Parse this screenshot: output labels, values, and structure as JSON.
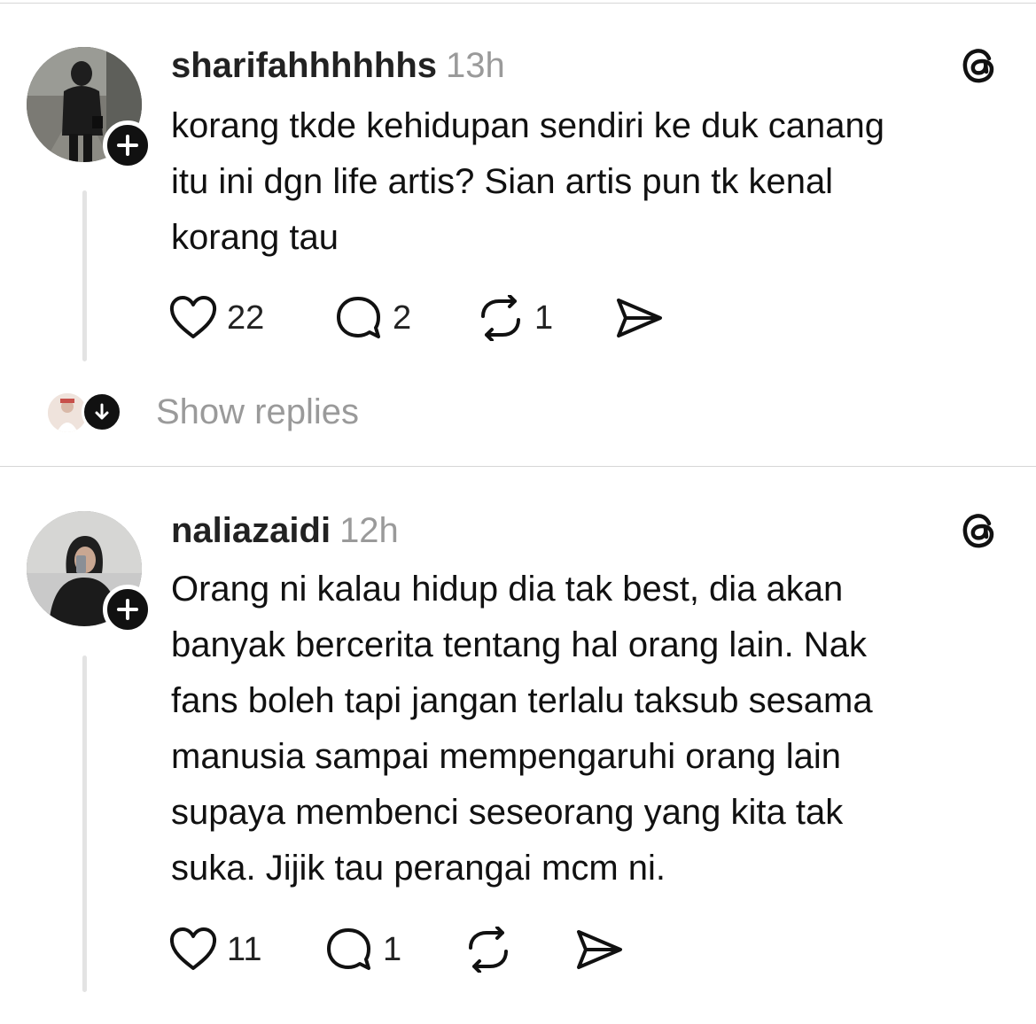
{
  "posts": [
    {
      "username": "sharifahhhhhhs",
      "time": "13h",
      "text": "korang tkde kehidupan sendiri ke duk canang\nitu ini dgn life artis? Sian artis pun tk kenal\nkorang tau",
      "likes": "22",
      "replies": "2",
      "reposts": "1",
      "show_replies_label": "Show replies",
      "avatar_icon": "photo-avatar-icon",
      "badge_icon": "plus-icon"
    },
    {
      "username": "naliazaidi",
      "time": "12h",
      "text": "Orang ni kalau hidup dia tak best, dia akan\nbanyak bercerita tentang hal orang lain. Nak\nfans boleh tapi jangan terlalu taksub sesama\nmanusia sampai mempengaruhi orang lain\nsupaya membenci seseorang yang kita tak\nsuka. Jijik tau perangai mcm ni.",
      "likes": "11",
      "replies": "1",
      "reposts": "",
      "avatar_icon": "photo-avatar-icon",
      "badge_icon": "plus-icon"
    }
  ],
  "icons": {
    "like": "heart-icon",
    "reply": "comment-icon",
    "repost": "repost-icon",
    "share": "send-icon",
    "brand": "threads-logo-icon",
    "expand": "arrow-down-icon"
  },
  "colors": {
    "text": "#111111",
    "muted": "#9a9a9a",
    "divider": "#d6d6d6",
    "thread_line": "#e3e3e3",
    "badge": "#111111"
  }
}
